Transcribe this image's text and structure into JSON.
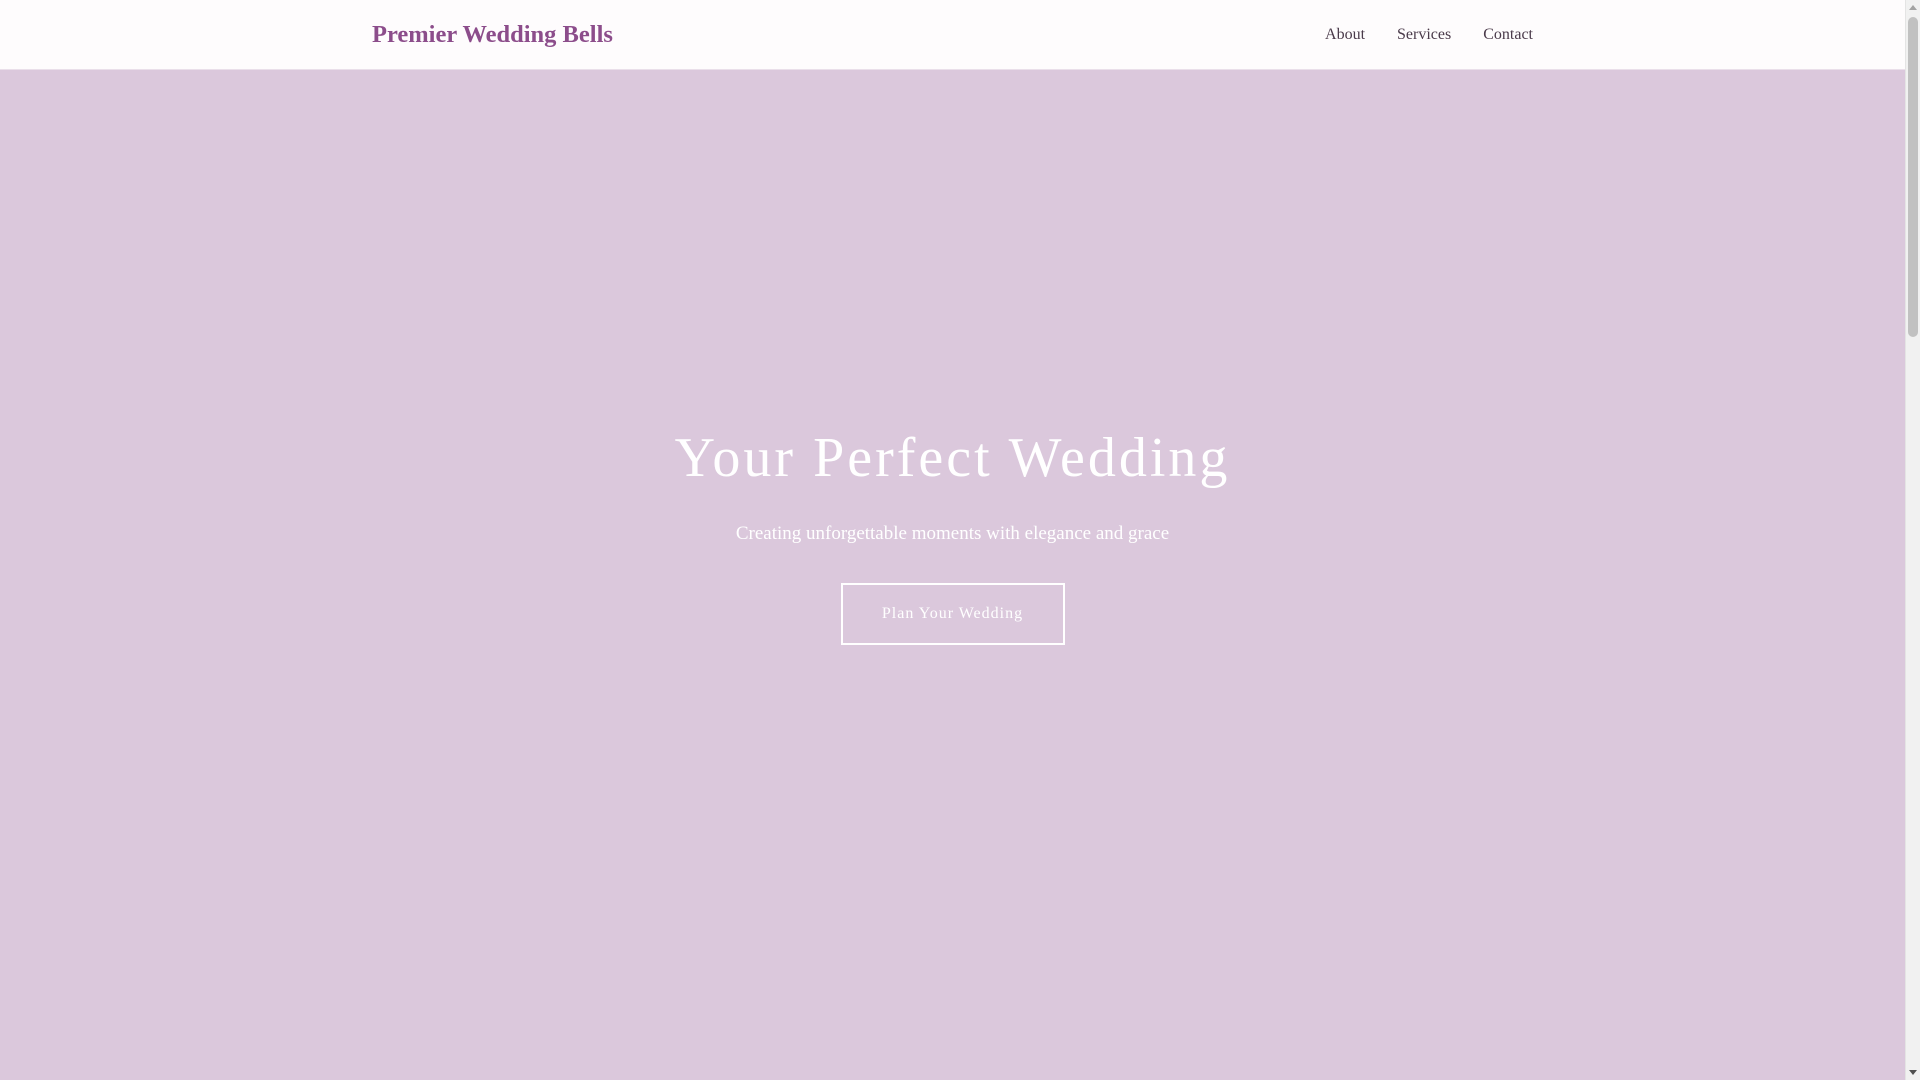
{
  "header": {
    "brand": "Premier Wedding Bells",
    "nav": [
      {
        "label": "About"
      },
      {
        "label": "Services"
      },
      {
        "label": "Contact"
      }
    ]
  },
  "hero": {
    "title": "Your Perfect Wedding",
    "subtitle": "Creating unforgettable moments with elegance and grace",
    "cta_label": "Plan Your Wedding"
  },
  "scrollbar": {
    "up_icon": "scroll-up-arrow-icon",
    "down_icon": "scroll-down-arrow-icon"
  },
  "colors": {
    "brand": "#8c4d8b",
    "hero_background": "#dbc8dc",
    "header_background": "#fefcfd",
    "nav_text": "#4a3a4a",
    "hero_text": "#ffffff"
  }
}
